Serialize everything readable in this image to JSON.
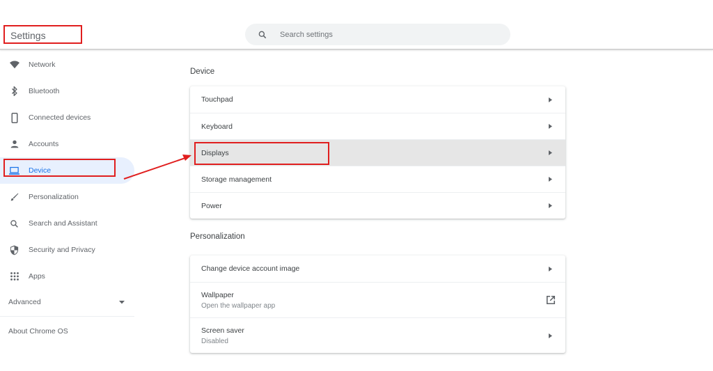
{
  "window": {
    "controls": [
      {
        "name": "minimize-button",
        "icon": "minimize-icon",
        "glyph": "—"
      },
      {
        "name": "restore-button",
        "icon": "restore-icon",
        "glyph": "❐"
      },
      {
        "name": "close-button",
        "icon": "close-icon",
        "glyph": "✕"
      }
    ]
  },
  "header": {
    "title": "Settings",
    "search": {
      "placeholder": "Search settings",
      "value": "",
      "icon": "search-icon"
    }
  },
  "sidebar": {
    "items": [
      {
        "label": "Network",
        "icon": "wifi-icon"
      },
      {
        "label": "Bluetooth",
        "icon": "bluetooth-icon"
      },
      {
        "label": "Connected devices",
        "icon": "phone-icon"
      },
      {
        "label": "Accounts",
        "icon": "person-icon"
      },
      {
        "label": "Device",
        "icon": "laptop-icon",
        "active": true
      },
      {
        "label": "Personalization",
        "icon": "brush-icon"
      },
      {
        "label": "Search and Assistant",
        "icon": "search-icon"
      },
      {
        "label": "Security and Privacy",
        "icon": "shield-icon"
      },
      {
        "label": "Apps",
        "icon": "apps-grid-icon"
      }
    ],
    "advanced_label": "Advanced",
    "about_label": "About Chrome OS"
  },
  "main": {
    "sections": [
      {
        "title": "Device",
        "rows": [
          {
            "label": "Touchpad",
            "action": "arrow"
          },
          {
            "label": "Keyboard",
            "action": "arrow"
          },
          {
            "label": "Displays",
            "action": "arrow",
            "hovered": true,
            "highlighted": true
          },
          {
            "label": "Storage management",
            "action": "arrow"
          },
          {
            "label": "Power",
            "action": "arrow"
          }
        ]
      },
      {
        "title": "Personalization",
        "rows": [
          {
            "label": "Change device account image",
            "action": "arrow"
          },
          {
            "label": "Wallpaper",
            "sublabel": "Open the wallpaper app",
            "action": "external"
          },
          {
            "label": "Screen saver",
            "sublabel": "Disabled",
            "action": "arrow"
          }
        ]
      }
    ]
  },
  "annotation": {
    "color": "#e01e1e",
    "from": "sidebar Device",
    "to": "Displays row"
  },
  "colors": {
    "accent": "#1a73e8",
    "active_bg": "#e8f0fe",
    "highlight": "#e01e1e",
    "hover_row": "#e6e6e6"
  }
}
